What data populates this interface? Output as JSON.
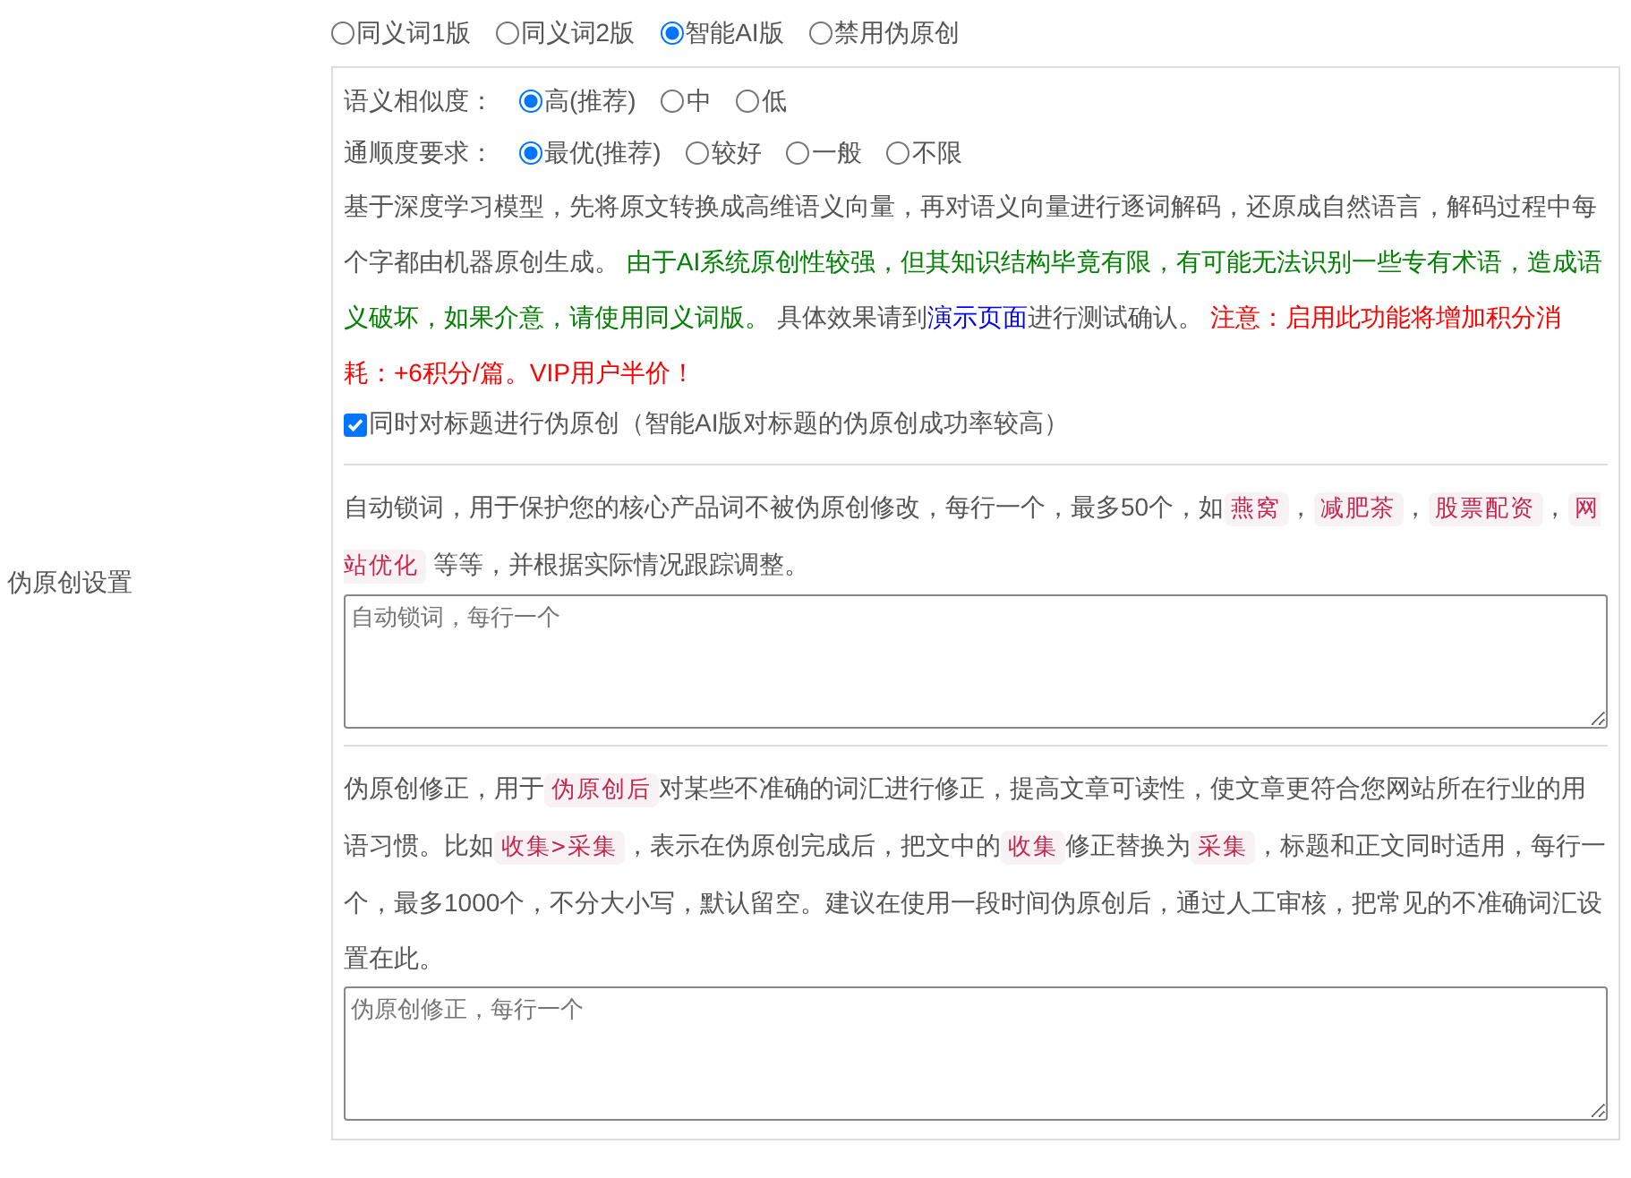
{
  "section_label": "伪原创设置",
  "modes": [
    {
      "label": "同义词1版",
      "selected": false
    },
    {
      "label": "同义词2版",
      "selected": false
    },
    {
      "label": "智能AI版",
      "selected": true
    },
    {
      "label": "禁用伪原创",
      "selected": false
    }
  ],
  "ai_settings": {
    "similarity": {
      "label": "语义相似度：",
      "options": [
        {
          "label": "高(推荐)",
          "selected": true
        },
        {
          "label": "中",
          "selected": false
        },
        {
          "label": "低",
          "selected": false
        }
      ]
    },
    "fluency": {
      "label": "通顺度要求：",
      "options": [
        {
          "label": "最优(推荐)",
          "selected": true
        },
        {
          "label": "较好",
          "selected": false
        },
        {
          "label": "一般",
          "selected": false
        },
        {
          "label": "不限",
          "selected": false
        }
      ]
    },
    "description": [
      {
        "kind": "plain",
        "text": "基于深度学习模型，先将原文转换成高维语义向量，再对语义向量进行逐词解码，还原成自然语言，解码过程中每个字都由机器原创生成。 "
      },
      {
        "kind": "note",
        "text": "由于AI系统原创性较强，但其知识结构毕竟有限，有可能无法识别一些专有术语，造成语义破坏，如果介意，请使用同义词版。"
      },
      {
        "kind": "plain",
        "text": " 具体效果请到"
      },
      {
        "kind": "link",
        "text": "演示页面"
      },
      {
        "kind": "plain",
        "text": "进行测试确认。 "
      },
      {
        "kind": "warning",
        "text": "注意：启用此功能将增加积分消耗：+6积分/篇。VIP用户半价！"
      }
    ],
    "title_option": {
      "label": "同时对标题进行伪原创（智能AI版对标题的伪原创成功率较高）",
      "checked": true
    }
  },
  "lock_words": {
    "description": [
      {
        "kind": "plain",
        "text": "自动锁词，用于保护您的核心产品词不被伪原创修改，每行一个，最多50个，如"
      },
      {
        "kind": "code",
        "text": "燕窝"
      },
      {
        "kind": "plain",
        "text": "，"
      },
      {
        "kind": "code",
        "text": "减肥茶"
      },
      {
        "kind": "plain",
        "text": "，"
      },
      {
        "kind": "code",
        "text": "股票配资"
      },
      {
        "kind": "plain",
        "text": "，"
      },
      {
        "kind": "code",
        "text": "网站优化"
      },
      {
        "kind": "plain",
        "text": " 等等，并根据实际情况跟踪调整。"
      }
    ],
    "placeholder": "自动锁词，每行一个"
  },
  "corrections": {
    "description": [
      {
        "kind": "plain",
        "text": "伪原创修正，用于"
      },
      {
        "kind": "code",
        "text": "伪原创后"
      },
      {
        "kind": "plain",
        "text": "对某些不准确的词汇进行修正，提高文章可读性，使文章更符合您网站所在行业的用语习惯。比如"
      },
      {
        "kind": "code",
        "text": "收集>采集"
      },
      {
        "kind": "plain",
        "text": "，表示在伪原创完成后，把文中的"
      },
      {
        "kind": "code",
        "text": "收集"
      },
      {
        "kind": "plain",
        "text": "修正替换为"
      },
      {
        "kind": "code",
        "text": "采集"
      },
      {
        "kind": "plain",
        "text": "，标题和正文同时适用，每行一个，最多1000个，不分大小写，默认留空。建议在使用一段时间伪原创后，通过人工审核，把常见的不准确词汇设置在此。"
      }
    ],
    "placeholder": "伪原创修正，每行一个"
  }
}
